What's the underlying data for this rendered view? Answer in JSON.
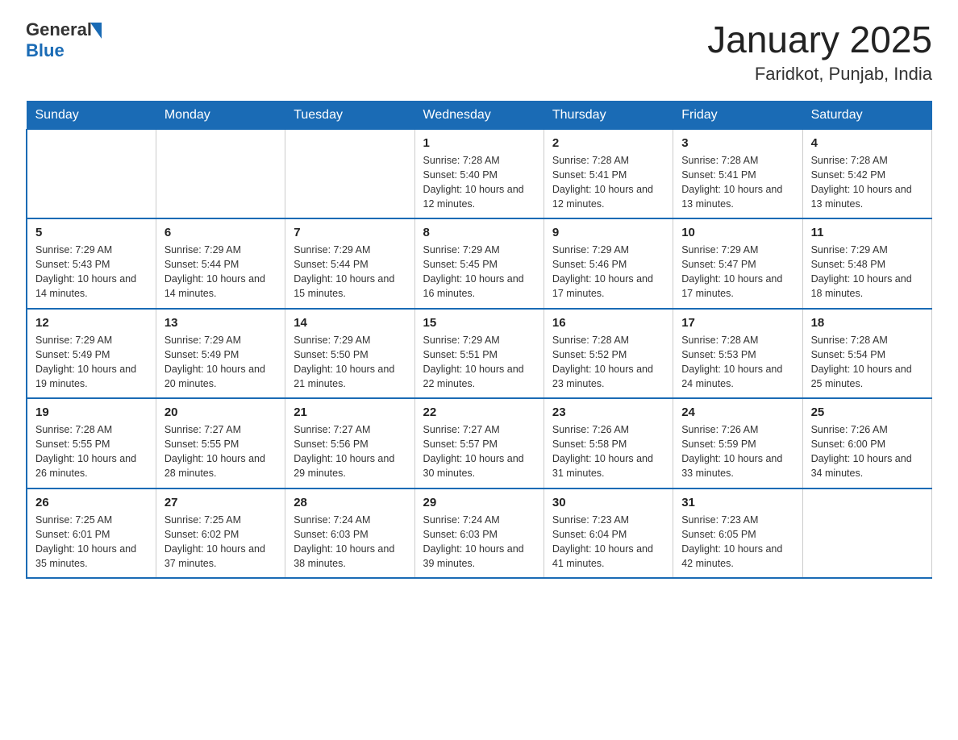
{
  "header": {
    "logo": {
      "general": "General",
      "blue": "Blue"
    },
    "title": "January 2025",
    "subtitle": "Faridkot, Punjab, India"
  },
  "days_of_week": [
    "Sunday",
    "Monday",
    "Tuesday",
    "Wednesday",
    "Thursday",
    "Friday",
    "Saturday"
  ],
  "weeks": [
    [
      {
        "day": "",
        "info": ""
      },
      {
        "day": "",
        "info": ""
      },
      {
        "day": "",
        "info": ""
      },
      {
        "day": "1",
        "info": "Sunrise: 7:28 AM\nSunset: 5:40 PM\nDaylight: 10 hours\nand 12 minutes."
      },
      {
        "day": "2",
        "info": "Sunrise: 7:28 AM\nSunset: 5:41 PM\nDaylight: 10 hours\nand 12 minutes."
      },
      {
        "day": "3",
        "info": "Sunrise: 7:28 AM\nSunset: 5:41 PM\nDaylight: 10 hours\nand 13 minutes."
      },
      {
        "day": "4",
        "info": "Sunrise: 7:28 AM\nSunset: 5:42 PM\nDaylight: 10 hours\nand 13 minutes."
      }
    ],
    [
      {
        "day": "5",
        "info": "Sunrise: 7:29 AM\nSunset: 5:43 PM\nDaylight: 10 hours\nand 14 minutes."
      },
      {
        "day": "6",
        "info": "Sunrise: 7:29 AM\nSunset: 5:44 PM\nDaylight: 10 hours\nand 14 minutes."
      },
      {
        "day": "7",
        "info": "Sunrise: 7:29 AM\nSunset: 5:44 PM\nDaylight: 10 hours\nand 15 minutes."
      },
      {
        "day": "8",
        "info": "Sunrise: 7:29 AM\nSunset: 5:45 PM\nDaylight: 10 hours\nand 16 minutes."
      },
      {
        "day": "9",
        "info": "Sunrise: 7:29 AM\nSunset: 5:46 PM\nDaylight: 10 hours\nand 17 minutes."
      },
      {
        "day": "10",
        "info": "Sunrise: 7:29 AM\nSunset: 5:47 PM\nDaylight: 10 hours\nand 17 minutes."
      },
      {
        "day": "11",
        "info": "Sunrise: 7:29 AM\nSunset: 5:48 PM\nDaylight: 10 hours\nand 18 minutes."
      }
    ],
    [
      {
        "day": "12",
        "info": "Sunrise: 7:29 AM\nSunset: 5:49 PM\nDaylight: 10 hours\nand 19 minutes."
      },
      {
        "day": "13",
        "info": "Sunrise: 7:29 AM\nSunset: 5:49 PM\nDaylight: 10 hours\nand 20 minutes."
      },
      {
        "day": "14",
        "info": "Sunrise: 7:29 AM\nSunset: 5:50 PM\nDaylight: 10 hours\nand 21 minutes."
      },
      {
        "day": "15",
        "info": "Sunrise: 7:29 AM\nSunset: 5:51 PM\nDaylight: 10 hours\nand 22 minutes."
      },
      {
        "day": "16",
        "info": "Sunrise: 7:28 AM\nSunset: 5:52 PM\nDaylight: 10 hours\nand 23 minutes."
      },
      {
        "day": "17",
        "info": "Sunrise: 7:28 AM\nSunset: 5:53 PM\nDaylight: 10 hours\nand 24 minutes."
      },
      {
        "day": "18",
        "info": "Sunrise: 7:28 AM\nSunset: 5:54 PM\nDaylight: 10 hours\nand 25 minutes."
      }
    ],
    [
      {
        "day": "19",
        "info": "Sunrise: 7:28 AM\nSunset: 5:55 PM\nDaylight: 10 hours\nand 26 minutes."
      },
      {
        "day": "20",
        "info": "Sunrise: 7:27 AM\nSunset: 5:55 PM\nDaylight: 10 hours\nand 28 minutes."
      },
      {
        "day": "21",
        "info": "Sunrise: 7:27 AM\nSunset: 5:56 PM\nDaylight: 10 hours\nand 29 minutes."
      },
      {
        "day": "22",
        "info": "Sunrise: 7:27 AM\nSunset: 5:57 PM\nDaylight: 10 hours\nand 30 minutes."
      },
      {
        "day": "23",
        "info": "Sunrise: 7:26 AM\nSunset: 5:58 PM\nDaylight: 10 hours\nand 31 minutes."
      },
      {
        "day": "24",
        "info": "Sunrise: 7:26 AM\nSunset: 5:59 PM\nDaylight: 10 hours\nand 33 minutes."
      },
      {
        "day": "25",
        "info": "Sunrise: 7:26 AM\nSunset: 6:00 PM\nDaylight: 10 hours\nand 34 minutes."
      }
    ],
    [
      {
        "day": "26",
        "info": "Sunrise: 7:25 AM\nSunset: 6:01 PM\nDaylight: 10 hours\nand 35 minutes."
      },
      {
        "day": "27",
        "info": "Sunrise: 7:25 AM\nSunset: 6:02 PM\nDaylight: 10 hours\nand 37 minutes."
      },
      {
        "day": "28",
        "info": "Sunrise: 7:24 AM\nSunset: 6:03 PM\nDaylight: 10 hours\nand 38 minutes."
      },
      {
        "day": "29",
        "info": "Sunrise: 7:24 AM\nSunset: 6:03 PM\nDaylight: 10 hours\nand 39 minutes."
      },
      {
        "day": "30",
        "info": "Sunrise: 7:23 AM\nSunset: 6:04 PM\nDaylight: 10 hours\nand 41 minutes."
      },
      {
        "day": "31",
        "info": "Sunrise: 7:23 AM\nSunset: 6:05 PM\nDaylight: 10 hours\nand 42 minutes."
      },
      {
        "day": "",
        "info": ""
      }
    ]
  ]
}
